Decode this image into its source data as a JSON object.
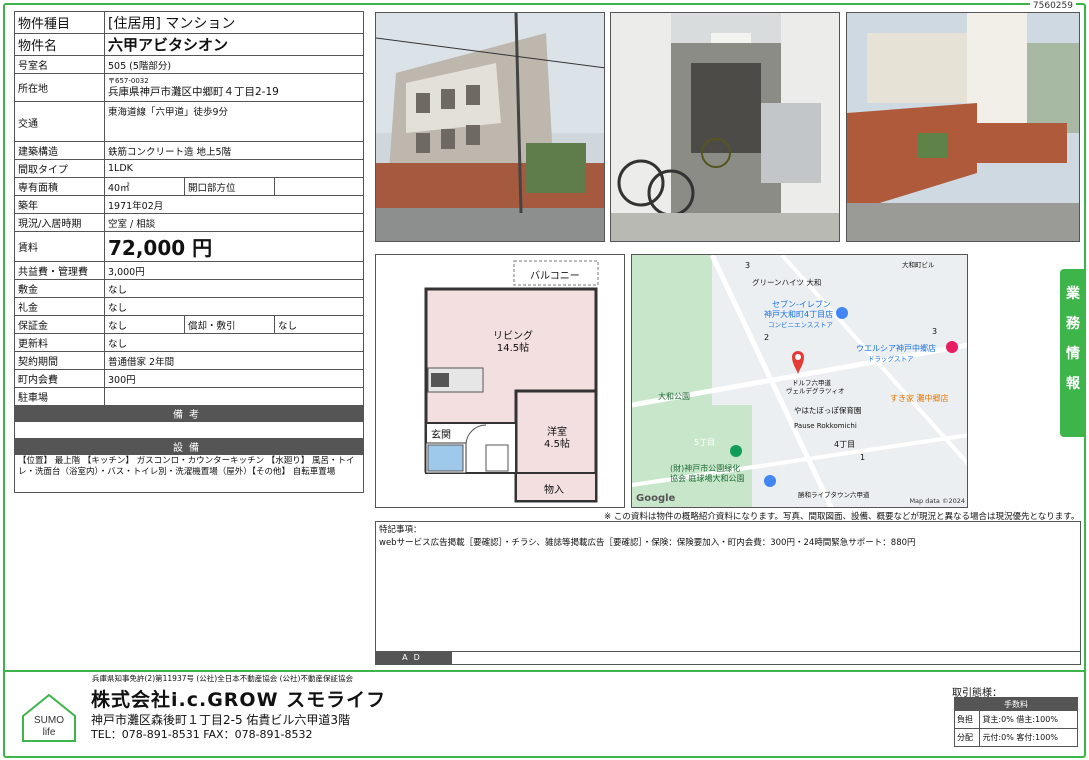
{
  "doc_id": "7560259",
  "property": {
    "type_label": "物件種目",
    "type_value": "[住居用] マンション",
    "name_label": "物件名",
    "name_value": "六甲アビタシオン",
    "room_label": "号室名",
    "room_value": "505 (5階部分)",
    "address_label": "所在地",
    "zip": "〒657-0032",
    "address": "兵庫県神戸市灘区中郷町４丁目2-19",
    "traffic_label": "交通",
    "traffic_value": "東海道線「六甲道」徒歩9分",
    "structure_label": "建築構造",
    "structure_value": "鉄筋コンクリート造 地上5階",
    "layout_label": "間取タイプ",
    "layout_value": "1LDK",
    "area_label": "専有面積",
    "area_value": "40㎡",
    "opening_label": "開口部方位",
    "opening_value": "",
    "built_label": "築年",
    "built_value": "1971年02月",
    "status_label": "現況/入居時期",
    "status_value": "空室 / 相談",
    "rent_label": "賃料",
    "rent_value": "72,000 円",
    "mgmt_label": "共益費・管理費",
    "mgmt_value": "3,000円",
    "deposit_label": "敷金",
    "deposit_value": "なし",
    "keymoney_label": "礼金",
    "keymoney_value": "なし",
    "guarantee_label": "保証金",
    "guarantee_value": "なし",
    "amort_label": "償却・敷引",
    "amort_value": "なし",
    "renewal_label": "更新料",
    "renewal_value": "なし",
    "contract_label": "契約期間",
    "contract_value": "普通借家 2年間",
    "town_label": "町内会費",
    "town_value": "300円",
    "parking_label": "駐車場",
    "parking_value": "",
    "remarks_header": "備考",
    "remarks_value": "",
    "equipment_header": "設備",
    "equipment_text": "【位置】 最上階 【キッチン】 ガスコンロ・カウンターキッチン 【水廻り】 風呂・トイレ・洗面台（浴室内）・バス・トイレ別・洗濯機置場（屋外）【その他】 自転車置場"
  },
  "floorplan": {
    "balcony": "バルコニー",
    "living": "リビング",
    "living_size": "14.5帖",
    "western": "洋室",
    "western_size": "4.5帖",
    "entrance": "玄関",
    "storage": "物入"
  },
  "map": {
    "labels": [
      "グリーンハイツ 大和",
      "セブン-イレブン",
      "神戸大和町4丁目店",
      "コンビニエンスストア",
      "ウエルシア神戸中郷店",
      "ドラッグストア",
      "ドルフ六甲道",
      "ヴェルデグラツィオ",
      "大和公園",
      "やはたぼっぽ保育園",
      "すき家 灘中郷店",
      "Pause Rokkomichi",
      "5丁目",
      "4丁目",
      "(財)神戸市公園緑化",
      "協会 庭球場大和公園",
      "勝和ライブタウン六甲道",
      "大和町ビル"
    ],
    "numbers": [
      "3",
      "2",
      "3",
      "1"
    ],
    "google": "Google",
    "attribution": "Map data ©2024"
  },
  "side_tab": [
    "業",
    "務",
    "情",
    "報"
  ],
  "note": "※ この資料は物件の概略紹介資料になります。写真、間取図面、設備、概要などが現況と異なる場合は現況優先となります。",
  "special": {
    "title": "特記事項：",
    "body": "webサービス広告掲載［要確認］・チラシ、雑誌等掲載広告［要確認］・保険：保険要加入・町内会費：300円・24時間緊急サポート：880円",
    "ad_label": "AD",
    "ad_value": ""
  },
  "company": {
    "license": "兵庫県知事免許(2)第11937号 (公社)全日本不動産協会 (公社)不動産保証協会",
    "name": "株式会社i.c.GROW スモライフ",
    "address": "神戸市灘区森後町１丁目2-5 佑貴ビル六甲道3階",
    "tel": "TEL：078-891-8531 FAX：078-891-8532",
    "logo_top": "SUMO",
    "logo_bottom": "life",
    "logo_kana": "スモライフ"
  },
  "fees": {
    "title": "取引態様：",
    "header": "手数料",
    "rows": [
      {
        "label": "負担",
        "value": "貸主:0% 借主:100%"
      },
      {
        "label": "分配",
        "value": "元付:0% 客付:100%"
      }
    ]
  },
  "colors": {
    "accent": "#3db54a",
    "header_gray": "#555555",
    "map_pin": "#e53935"
  }
}
